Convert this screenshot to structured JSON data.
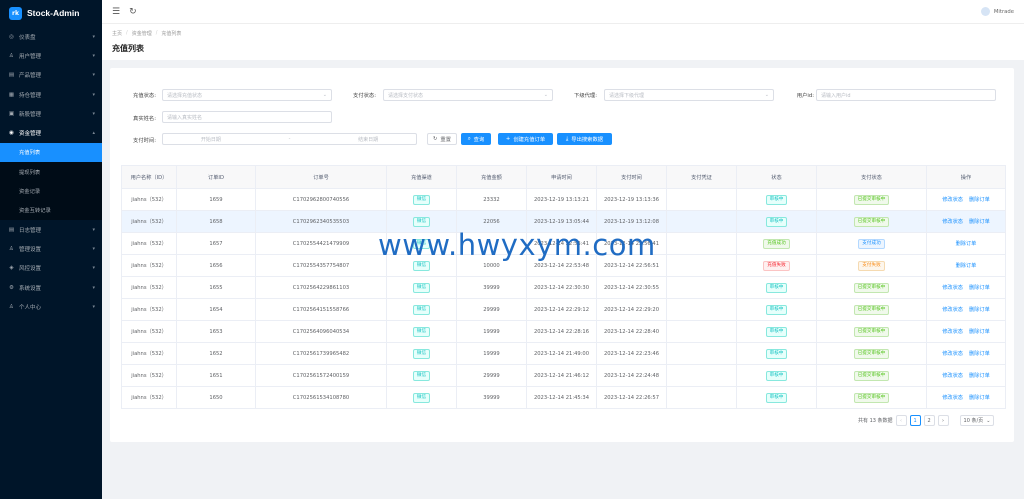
{
  "app": {
    "brand": "Stock-Admin",
    "logo_text": "rk"
  },
  "sidebar": {
    "items": [
      {
        "icon": "dashboard-icon",
        "glyph": "◎",
        "label": "仪表盘",
        "arrow": "▾"
      },
      {
        "icon": "user-icon",
        "glyph": "♙",
        "label": "用户管理",
        "arrow": "▾"
      },
      {
        "icon": "product-icon",
        "glyph": "▤",
        "label": "产品管理",
        "arrow": "▾"
      },
      {
        "icon": "grid-icon",
        "glyph": "▦",
        "label": "持仓管理",
        "arrow": "▾"
      },
      {
        "icon": "news-icon",
        "glyph": "▣",
        "label": "新股管理",
        "arrow": "▾"
      },
      {
        "icon": "fund-icon",
        "glyph": "◉",
        "label": "资金管理",
        "arrow": "▴"
      }
    ],
    "subitems": [
      "充值列表",
      "提现列表",
      "资金记录",
      "资金互转记录"
    ],
    "items_after": [
      {
        "icon": "log-icon",
        "glyph": "▤",
        "label": "日志管理",
        "arrow": "▾"
      },
      {
        "icon": "admin-icon",
        "glyph": "♙",
        "label": "管理设置",
        "arrow": "▾"
      },
      {
        "icon": "risk-icon",
        "glyph": "◈",
        "label": "风控设置",
        "arrow": "▾"
      },
      {
        "icon": "settings-icon",
        "glyph": "⚙",
        "label": "系统设置",
        "arrow": "▾"
      },
      {
        "icon": "person-icon",
        "glyph": "♙",
        "label": "个人中心",
        "arrow": "▾"
      }
    ]
  },
  "header": {
    "menu_glyph": "☰",
    "refresh_glyph": "↻",
    "user_name": "Mitrade"
  },
  "breadcrumb": [
    "主页",
    "资金管理",
    "充值列表"
  ],
  "breadcrumb_sep": "/",
  "page_title": "充值列表",
  "filters": {
    "charge_status": {
      "label": "充值状态:",
      "placeholder": "请选择充值状态"
    },
    "pay_status": {
      "label": "支付状态:",
      "placeholder": "请选择支付状态"
    },
    "agent": {
      "label": "下级代理:",
      "placeholder": "请选择下级代理"
    },
    "user_id": {
      "label": "用户id:",
      "placeholder": "请输入用户id"
    },
    "real_name": {
      "label": "真实姓名:",
      "placeholder": "请输入真实姓名"
    },
    "pay_time": {
      "label": "支付时间:",
      "start": "开始日期",
      "dash": "-",
      "end": "结束日期"
    },
    "dropdown_glyph": "⌄"
  },
  "buttons": {
    "reset": {
      "glyph": "↻",
      "label": "重置"
    },
    "search": {
      "glyph": "⌕",
      "label": "查询"
    },
    "create": {
      "glyph": "+",
      "label": "创建充值订单"
    },
    "export": {
      "glyph": "⤓",
      "label": "导出搜索数据"
    }
  },
  "table": {
    "headers": [
      "用户名称（ID）",
      "订单ID",
      "订单号",
      "充值渠道",
      "充值金额",
      "申请时间",
      "支付时间",
      "支付凭证",
      "状态",
      "支付状态",
      "操作"
    ],
    "rows": [
      {
        "user": "jiahns（532）",
        "id": "1659",
        "order": "C170296280074055​6",
        "channel": "微信",
        "amount": "23332",
        "apply": "2023-12-19 13:13:21",
        "pay": "2023-12-19 13:13:36",
        "status": "审核中",
        "status_color": "cyan",
        "pay_status": "已提交审核中",
        "pay_color": "green",
        "ops": [
          "修改状态",
          "删除订单"
        ],
        "hl": false
      },
      {
        "user": "jiahns（532）",
        "id": "1658",
        "order": "C1702962340535503",
        "channel": "微信",
        "amount": "22056",
        "apply": "2023-12-19 13:05:44",
        "pay": "2023-12-19 13:12:08",
        "status": "审核中",
        "status_color": "cyan",
        "pay_status": "已提交审核中",
        "pay_color": "green",
        "ops": [
          "修改状态",
          "删除订单"
        ],
        "hl": true
      },
      {
        "user": "jiahns（532）",
        "id": "1657",
        "order": "C1702554421479909",
        "channel": "微信",
        "amount": "",
        "apply": "2023-12-14 22:53:41",
        "pay": "2023-12-14 22:56:41",
        "status": "充值成功",
        "status_color": "green",
        "pay_status": "支付成功",
        "pay_color": "blue",
        "ops": [
          "删除订单"
        ],
        "hl": false
      },
      {
        "user": "jiahns（532）",
        "id": "1656",
        "order": "C1702554357754807",
        "channel": "微信",
        "amount": "10000",
        "apply": "2023-12-14 22:53:48",
        "pay": "2023-12-14 22:56:51",
        "status": "充值失败",
        "status_color": "red",
        "pay_status": "支付失败",
        "pay_color": "orange",
        "ops": [
          "删除订单"
        ],
        "hl": false
      },
      {
        "user": "jiahns（532）",
        "id": "1655",
        "order": "C1702564229861103",
        "channel": "微信",
        "amount": "39999",
        "apply": "2023-12-14 22:30:30",
        "pay": "2023-12-14 22:30:55",
        "status": "审核中",
        "status_color": "cyan",
        "pay_status": "已提交审核中",
        "pay_color": "green",
        "ops": [
          "修改状态",
          "删除订单"
        ],
        "hl": false
      },
      {
        "user": "jiahns（532）",
        "id": "1654",
        "order": "C1702564151558766",
        "channel": "微信",
        "amount": "29999",
        "apply": "2023-12-14 22:29:12",
        "pay": "2023-12-14 22:29:20",
        "status": "审核中",
        "status_color": "cyan",
        "pay_status": "已提交审核中",
        "pay_color": "green",
        "ops": [
          "修改状态",
          "删除订单"
        ],
        "hl": false
      },
      {
        "user": "jiahns（532）",
        "id": "1653",
        "order": "C1702564096040534",
        "channel": "微信",
        "amount": "19999",
        "apply": "2023-12-14 22:28:16",
        "pay": "2023-12-14 22:28:40",
        "status": "审核中",
        "status_color": "cyan",
        "pay_status": "已提交审核中",
        "pay_color": "green",
        "ops": [
          "修改状态",
          "删除订单"
        ],
        "hl": false
      },
      {
        "user": "jiahns（532）",
        "id": "1652",
        "order": "C1702561739965482",
        "channel": "微信",
        "amount": "19999",
        "apply": "2023-12-14 21:49:00",
        "pay": "2023-12-14 22:23:46",
        "status": "审核中",
        "status_color": "cyan",
        "pay_status": "已提交审核中",
        "pay_color": "green",
        "ops": [
          "修改状态",
          "删除订单"
        ],
        "hl": false
      },
      {
        "user": "jiahns（532）",
        "id": "1651",
        "order": "C1702561572400159",
        "channel": "微信",
        "amount": "29999",
        "apply": "2023-12-14 21:46:12",
        "pay": "2023-12-14 22:24:48",
        "status": "审核中",
        "status_color": "cyan",
        "pay_status": "已提交审核中",
        "pay_color": "green",
        "ops": [
          "修改状态",
          "删除订单"
        ],
        "hl": false
      },
      {
        "user": "jiahns（532）",
        "id": "1650",
        "order": "C1702561534108780",
        "channel": "微信",
        "amount": "39999",
        "apply": "2023-12-14 21:45:34",
        "pay": "2023-12-14 22:26:57",
        "status": "审核中",
        "status_color": "cyan",
        "pay_status": "已提交审核中",
        "pay_color": "green",
        "ops": [
          "修改状态",
          "删除订单"
        ],
        "hl": false
      }
    ]
  },
  "pagination": {
    "total_text": "共有 13 条数据",
    "prev": "‹",
    "pages": [
      "1",
      "2"
    ],
    "current": "1",
    "next": "›",
    "page_size": "10 条/页",
    "size_glyph": "⌄"
  },
  "watermark": "www.hwyxym.com",
  "colors": {
    "sidebar_bg": "#001529",
    "accent": "#1890ff"
  }
}
